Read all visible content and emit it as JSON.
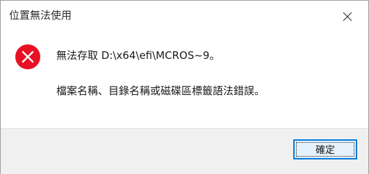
{
  "dialog": {
    "title": "位置無法使用",
    "close_icon": "close-icon",
    "error_icon": "error-icon",
    "error_color": "#e81123",
    "message_line1": "無法存取 D:\\x64\\efi\\MCROS~9。",
    "message_line2": "檔案名稱、目錄名稱或磁碟區標籤語法錯誤。",
    "ok_label": "確定",
    "ok_border_color": "#0078d7"
  }
}
